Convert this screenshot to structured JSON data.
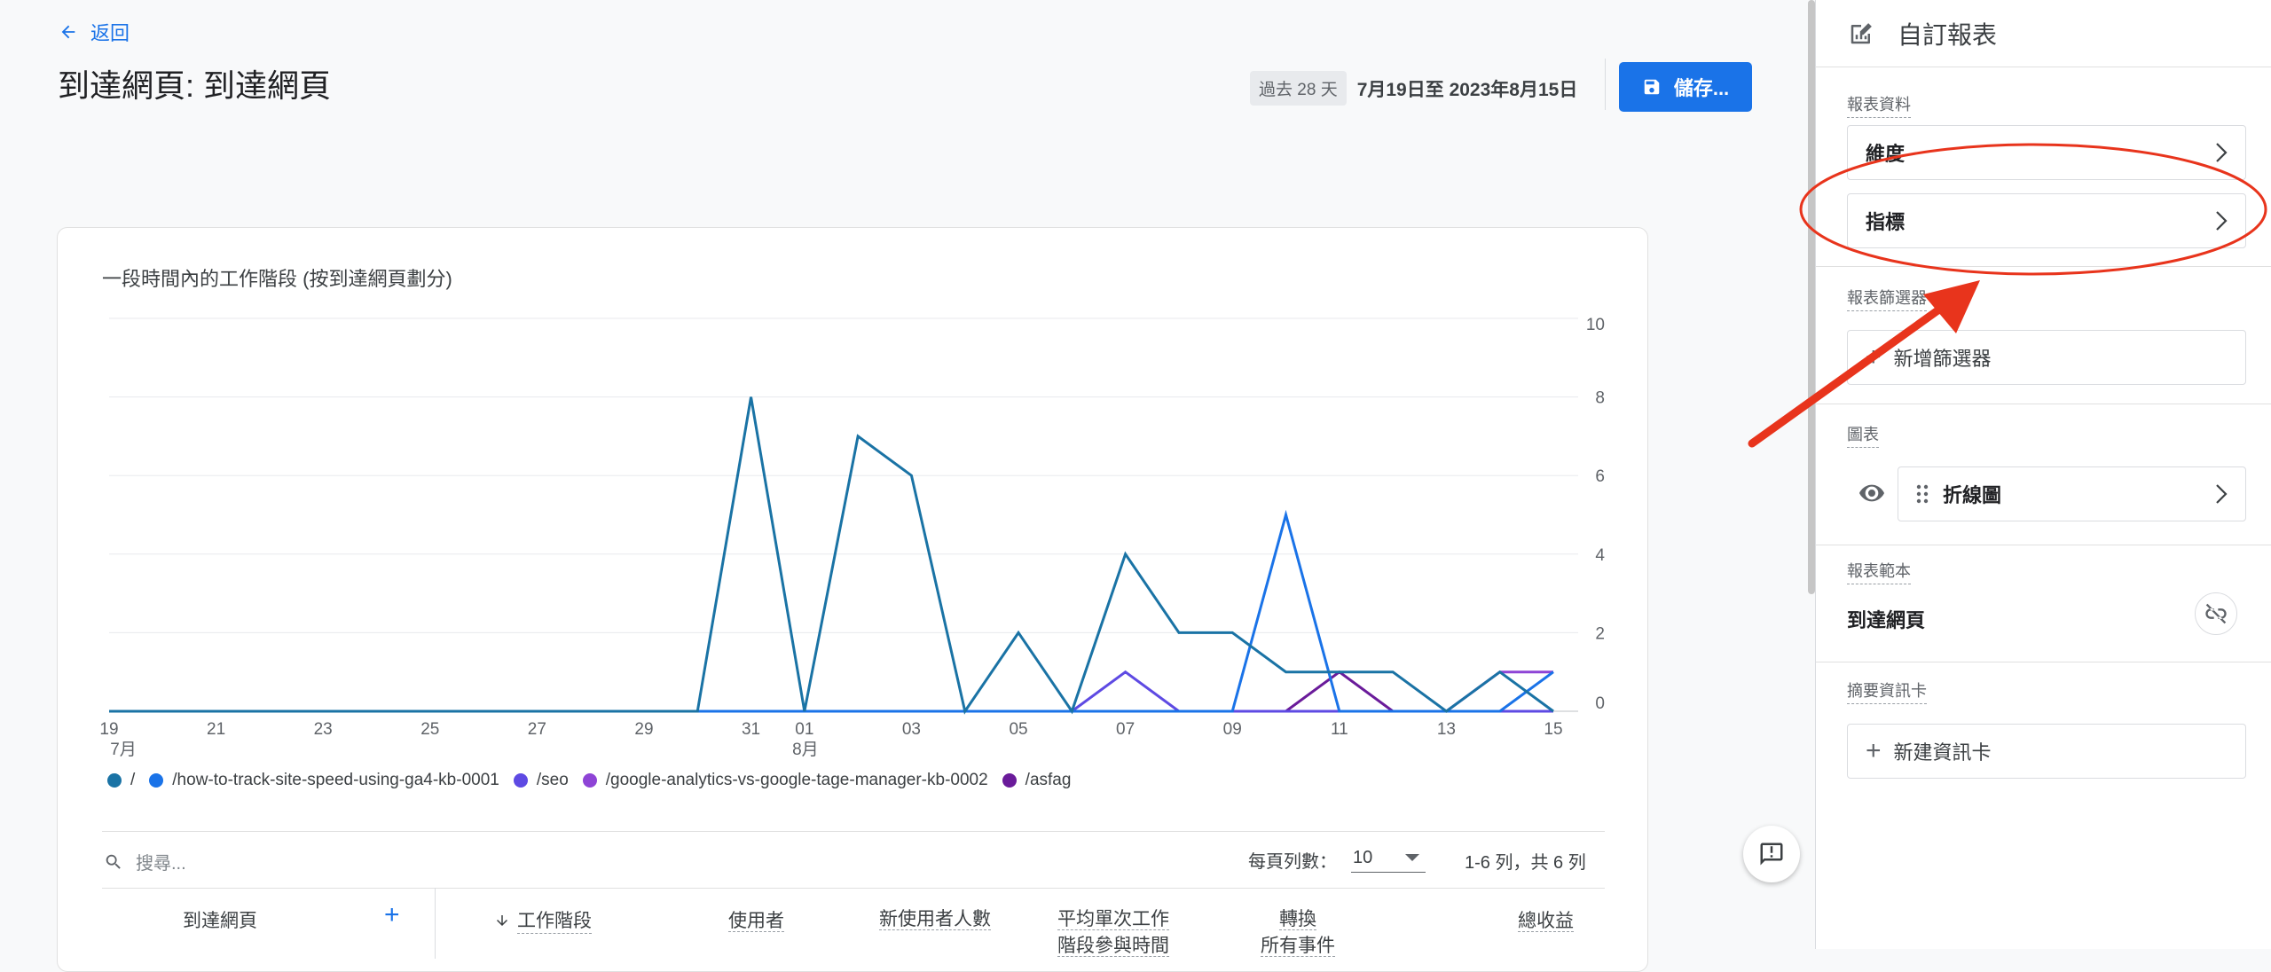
{
  "header": {
    "back_label": "返回",
    "title": "到達網頁: 到達網頁",
    "date_chip": "過去 28 天",
    "date_range": "7月19日至 2023年8月15日",
    "save_label": "儲存..."
  },
  "chart": {
    "title": "一段時間內的工作階段 (按到達網頁劃分)"
  },
  "chart_data": {
    "type": "line",
    "title": "一段時間內的工作階段 (按到達網頁劃分)",
    "x_ticks": [
      "19",
      "21",
      "23",
      "25",
      "27",
      "29",
      "31",
      "01",
      "03",
      "05",
      "07",
      "09",
      "11",
      "13",
      "15"
    ],
    "x_month_labels": [
      "7月",
      "8月"
    ],
    "y_ticks": [
      "0",
      "2",
      "4",
      "6",
      "8",
      "10"
    ],
    "ylim": [
      0,
      10
    ],
    "grid": true,
    "legend_position": "bottom",
    "x": [
      "07-19",
      "07-20",
      "07-21",
      "07-22",
      "07-23",
      "07-24",
      "07-25",
      "07-26",
      "07-27",
      "07-28",
      "07-29",
      "07-30",
      "07-31",
      "08-01",
      "08-02",
      "08-03",
      "08-04",
      "08-05",
      "08-06",
      "08-07",
      "08-08",
      "08-09",
      "08-10",
      "08-11",
      "08-12",
      "08-13",
      "08-14",
      "08-15"
    ],
    "series": [
      {
        "name": "/",
        "color": "#1a73a5",
        "values": [
          0,
          0,
          0,
          0,
          0,
          0,
          0,
          0,
          0,
          0,
          0,
          0,
          8,
          0,
          7,
          6,
          0,
          2,
          0,
          4,
          2,
          2,
          1,
          1,
          1,
          0,
          1,
          0
        ]
      },
      {
        "name": "/how-to-track-site-speed-using-ga4-kb-0001",
        "color": "#1a73e8",
        "values": [
          0,
          0,
          0,
          0,
          0,
          0,
          0,
          0,
          0,
          0,
          0,
          0,
          0,
          0,
          0,
          0,
          0,
          0,
          0,
          0,
          0,
          0,
          5,
          0,
          0,
          0,
          0,
          1
        ]
      },
      {
        "name": "/seo",
        "color": "#5e4ae3",
        "values": [
          0,
          0,
          0,
          0,
          0,
          0,
          0,
          0,
          0,
          0,
          0,
          0,
          0,
          0,
          0,
          0,
          0,
          0,
          0,
          1,
          0,
          0,
          0,
          0,
          0,
          0,
          0,
          0
        ]
      },
      {
        "name": "/google-analytics-vs-google-tage-manager-kb-0002",
        "color": "#8e44d6",
        "values": [
          0,
          0,
          0,
          0,
          0,
          0,
          0,
          0,
          0,
          0,
          0,
          0,
          0,
          0,
          0,
          0,
          0,
          0,
          0,
          0,
          0,
          0,
          0,
          0,
          0,
          0,
          1,
          1
        ]
      },
      {
        "name": "/asfag",
        "color": "#6a1b9a",
        "values": [
          0,
          0,
          0,
          0,
          0,
          0,
          0,
          0,
          0,
          0,
          0,
          0,
          0,
          0,
          0,
          0,
          0,
          0,
          0,
          0,
          0,
          0,
          0,
          1,
          0,
          0,
          0,
          0
        ]
      }
    ]
  },
  "table": {
    "search_placeholder": "搜尋...",
    "rows_per_page_label": "每頁列數：",
    "rows_per_page_value": "10",
    "pagination": "1-6 列，共 6 列",
    "columns": [
      "到達網頁",
      "工作階段",
      "使用者",
      "新使用者人數",
      "平均單次工作階段參與時間",
      "轉換",
      "總收益"
    ],
    "conversions_sub": "所有事件"
  },
  "panel": {
    "title": "自訂報表",
    "report_data_label": "報表資料",
    "dimensions_label": "維度",
    "metrics_label": "指標",
    "filters_label": "報表篩選器",
    "add_filter_label": "新增篩選器",
    "charts_label": "圖表",
    "chart_type_label": "折線圖",
    "template_label": "報表範本",
    "template_value": "到達網頁",
    "summary_cards_label": "摘要資訊卡",
    "new_card_label": "新建資訊卡"
  },
  "colors": {
    "accent": "#1a73e8",
    "annotation": "#e8341c"
  }
}
